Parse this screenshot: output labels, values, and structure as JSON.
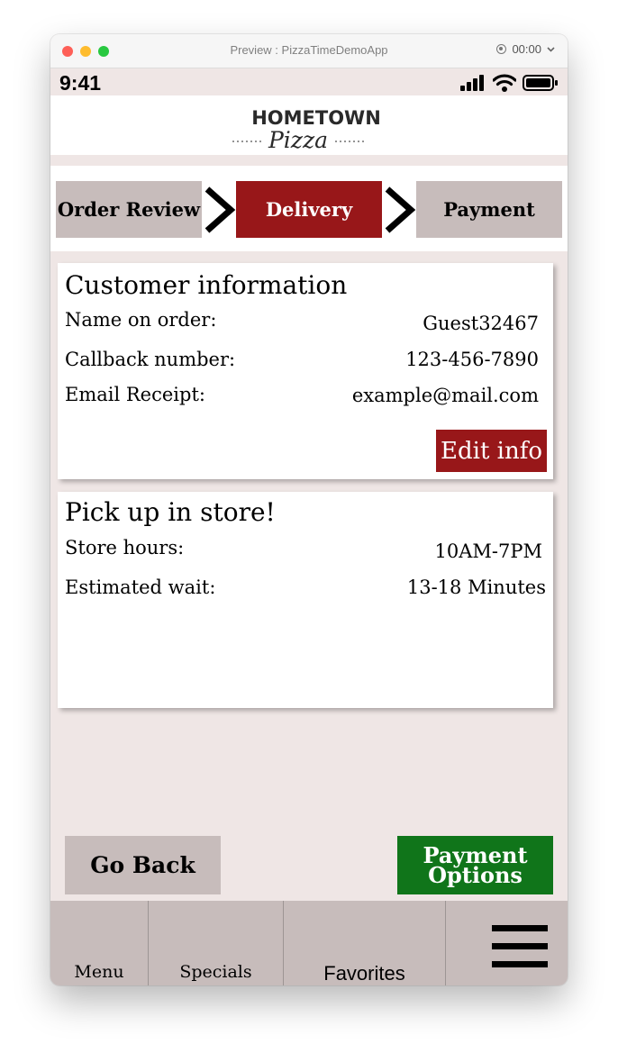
{
  "window": {
    "title": "Preview : PizzaTimeDemoApp",
    "recording_time": "00:00"
  },
  "status_bar": {
    "time": "9:41"
  },
  "header": {
    "logo_top": "HOMETOWN",
    "logo_bottom": "Pizza"
  },
  "steps": [
    {
      "label": "Order Review",
      "active": false
    },
    {
      "label": "Delivery",
      "active": true
    },
    {
      "label": "Payment",
      "active": false
    }
  ],
  "customer": {
    "title": "Customer information",
    "rows": [
      {
        "label": "Name on order:",
        "value": "Guest32467"
      },
      {
        "label": "Callback number:",
        "value": "123-456-7890"
      },
      {
        "label": "Email Receipt:",
        "value": "example@mail.com"
      }
    ],
    "edit_label": "Edit info"
  },
  "pickup": {
    "title": "Pick up in store!",
    "rows": [
      {
        "label": "Store hours:",
        "value": "10AM-7PM"
      },
      {
        "label": "Estimated wait:",
        "value": "13-18 Minutes"
      }
    ]
  },
  "actions": {
    "back": "Go Back",
    "payment_line1": "Payment",
    "payment_line2": "Options"
  },
  "tabbar": {
    "tabs": [
      {
        "label": "Menu",
        "icon": "menu"
      },
      {
        "label": "Specials",
        "icon": "specials"
      },
      {
        "label": "Favorites",
        "icon": "favorites"
      }
    ],
    "more_icon": "hamburger-icon"
  },
  "colors": {
    "brand_red": "#981719",
    "pay_green": "#10751a",
    "step_gray": "#c7bcbb",
    "page_bg": "#efe6e5"
  }
}
